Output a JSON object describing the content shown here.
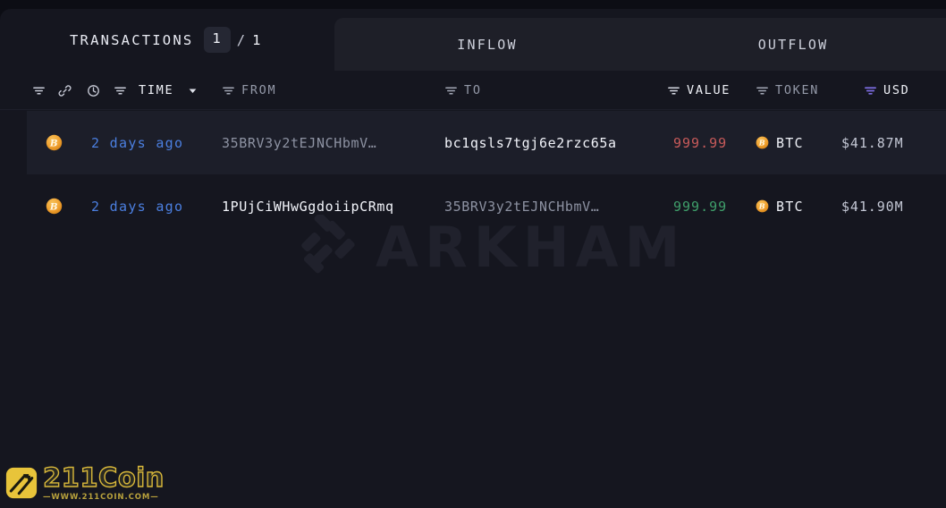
{
  "panel": {
    "title": "TRANSACTIONS",
    "pager": {
      "current": "1",
      "separator": "/",
      "total": "1"
    }
  },
  "tabs": [
    {
      "label": "INFLOW",
      "name": "tab-inflow"
    },
    {
      "label": "OUTFLOW",
      "name": "tab-outflow"
    }
  ],
  "columns": [
    {
      "label": "TIME",
      "filter_icon": "filter-icon",
      "extra_icons": [
        "filter-icon",
        "link-icon",
        "clock-icon"
      ],
      "sort_icon": "chevron-down-icon",
      "active": true
    },
    {
      "label": "FROM",
      "filter_icon": "filter-icon",
      "active": false
    },
    {
      "label": "TO",
      "filter_icon": "filter-icon",
      "active": false
    },
    {
      "label": "VALUE",
      "filter_icon": "filter-icon",
      "active": true
    },
    {
      "label": "TOKEN",
      "filter_icon": "filter-icon",
      "active": false
    },
    {
      "label": "USD",
      "filter_icon": "filter-icon-active",
      "active": true
    }
  ],
  "rows": [
    {
      "chain_icon": "bitcoin-icon",
      "time": "2 days ago",
      "from": "35BRV3y2tEJNCHbmV…",
      "to": "bc1qsls7tgj6e2rzc65a",
      "value": "999.99",
      "value_direction": "negative",
      "token": "BTC",
      "token_icon": "bitcoin-icon",
      "usd": "$41.87M",
      "highlighted": true
    },
    {
      "chain_icon": "bitcoin-icon",
      "time": "2 days ago",
      "from": "1PUjCiWHwGgdoiipCRmq",
      "to": "35BRV3y2tEJNCHbmV…",
      "value": "999.99",
      "value_direction": "positive",
      "token": "BTC",
      "token_icon": "bitcoin-icon",
      "usd": "$41.90M",
      "highlighted": false
    }
  ],
  "watermark": {
    "text": "ARKHAM",
    "mark": "arkham-logo-icon"
  },
  "brand": {
    "name": "211Coin",
    "url": "—WWW.211COIN.COM—",
    "mark": "211coin-logo-icon"
  },
  "colors": {
    "background": "#0c0d14",
    "panel": "#15161f",
    "tab_bar": "#1e1f28",
    "row_hover": "#1c1e29",
    "time_blue": "#4b7fe0",
    "value_negative": "#c75a5a",
    "value_positive": "#3f9e6a",
    "filter_active_purple": "#7c6ce0",
    "bitcoin_orange": "#f2a33c",
    "brand_yellow": "#e8c43a"
  }
}
